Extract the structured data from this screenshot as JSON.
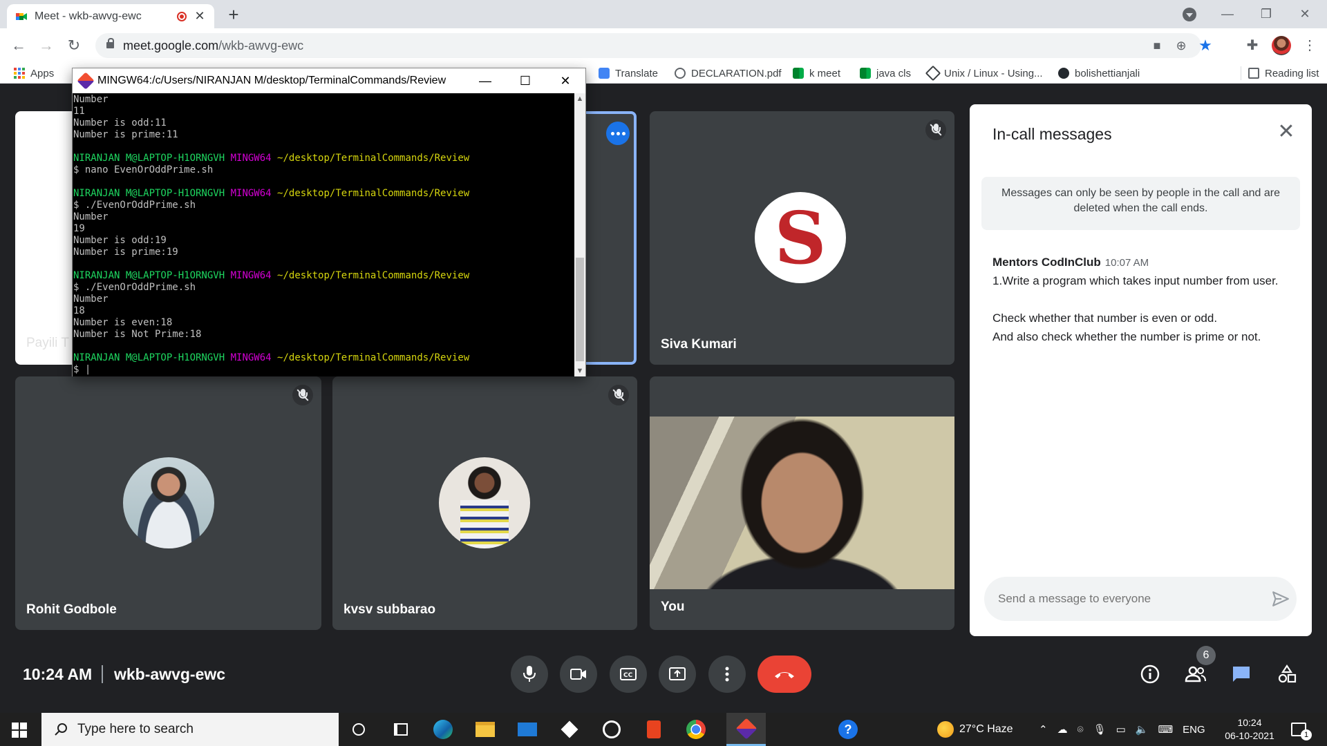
{
  "browser": {
    "tab_title": "Meet - wkb-awvg-ewc",
    "url_domain": "meet.google.com",
    "url_path": "/wkb-awvg-ewc",
    "bookmarks": [
      "Apps",
      "Translate",
      "DECLARATION.pdf",
      "k meet",
      "java cls",
      "Unix / Linux - Using...",
      "bolishettianjali"
    ],
    "reading_list": "Reading list"
  },
  "terminal": {
    "title": "MINGW64:/c/Users/NIRANJAN M/desktop/TerminalCommands/Review",
    "prompt_user": "NIRANJAN M@LAPTOP-H1ORNGVH",
    "prompt_shell": "MINGW64",
    "prompt_path": "~/desktop/TerminalCommands/Review",
    "lines": [
      {
        "kind": "out",
        "text": "Number"
      },
      {
        "kind": "out",
        "text": "11"
      },
      {
        "kind": "out",
        "text": "Number is odd:11"
      },
      {
        "kind": "out",
        "text": "Number is prime:11"
      },
      {
        "kind": "blank"
      },
      {
        "kind": "prompt"
      },
      {
        "kind": "out",
        "text": "$ nano EvenOrOddPrime.sh"
      },
      {
        "kind": "blank"
      },
      {
        "kind": "prompt"
      },
      {
        "kind": "out",
        "text": "$ ./EvenOrOddPrime.sh"
      },
      {
        "kind": "out",
        "text": "Number"
      },
      {
        "kind": "out",
        "text": "19"
      },
      {
        "kind": "out",
        "text": "Number is odd:19"
      },
      {
        "kind": "out",
        "text": "Number is prime:19"
      },
      {
        "kind": "blank"
      },
      {
        "kind": "prompt"
      },
      {
        "kind": "out",
        "text": "$ ./EvenOrOddPrime.sh"
      },
      {
        "kind": "out",
        "text": "Number"
      },
      {
        "kind": "out",
        "text": "18"
      },
      {
        "kind": "out",
        "text": "Number is even:18"
      },
      {
        "kind": "out",
        "text": "Number is Not Prime:18"
      },
      {
        "kind": "blank"
      },
      {
        "kind": "prompt"
      },
      {
        "kind": "out",
        "text": "$ |"
      }
    ]
  },
  "participants": {
    "payili": "Payili T",
    "siva": "Siva Kumari",
    "siva_initial": "S",
    "rohit": "Rohit Godbole",
    "kvsv": "kvsv subbarao",
    "you": "You"
  },
  "chat": {
    "title": "In-call messages",
    "note": "Messages can only be seen by people in the call and are deleted when the call ends.",
    "sender": "Mentors CodInClub",
    "time": "10:07 AM",
    "lines": [
      "1.Write a program which takes input number from user.",
      "Check whether that number is even or odd.",
      "And also check whether the number is prime or not."
    ],
    "input_placeholder": "Send a message to everyone"
  },
  "meeting": {
    "time": "10:24 AM",
    "code": "wkb-awvg-ewc",
    "people_count": "6"
  },
  "taskbar": {
    "search_placeholder": "Type here to search",
    "weather": "27°C  Haze",
    "lang": "ENG",
    "clock_time": "10:24",
    "clock_date": "06-10-2021",
    "notif_count": "1"
  },
  "colors": {
    "accent": "#1a73e8",
    "hangup": "#ea4335",
    "tile": "#3c4043"
  }
}
